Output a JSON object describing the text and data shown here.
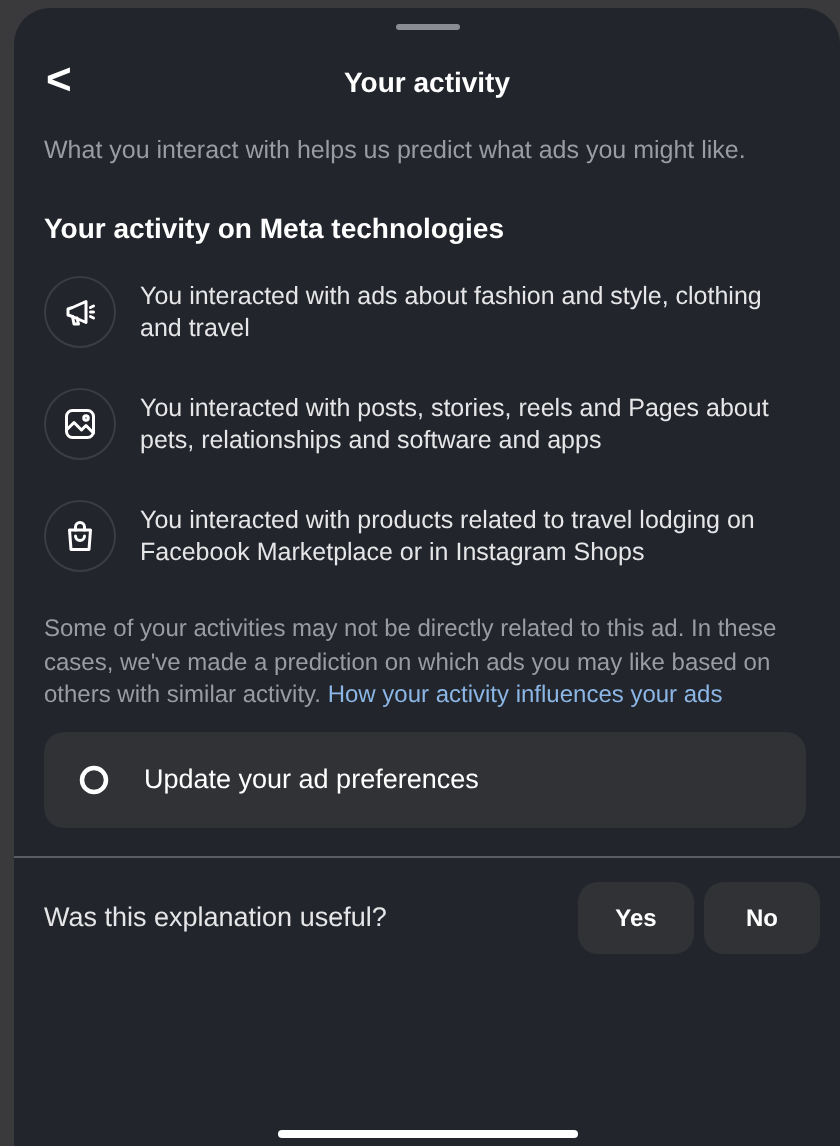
{
  "header": {
    "back": "<",
    "title": "Your activity"
  },
  "intro": "What you interact with helps us predict what ads you might like.",
  "section_title": "Your activity on Meta technologies",
  "activities": [
    {
      "kind": "megaphone",
      "text": "You interacted with ads about fashion and style, clothing and travel"
    },
    {
      "kind": "image",
      "text": "You interacted with posts, stories, reels and Pages about pets, relationships and software and apps"
    },
    {
      "kind": "bag",
      "text": "You interacted with products related to travel lodging on Facebook Marketplace or in Instagram Shops"
    }
  ],
  "note": "Some of your activities may not be directly related to this ad. In these cases, we've made a prediction on which ads you may like based on others with similar activity.",
  "note_link": "How your activity influences your ads",
  "preferences_button": "Update your ad preferences",
  "feedback": {
    "question": "Was this explanation useful?",
    "buttons": [
      "Yes",
      "No"
    ]
  }
}
